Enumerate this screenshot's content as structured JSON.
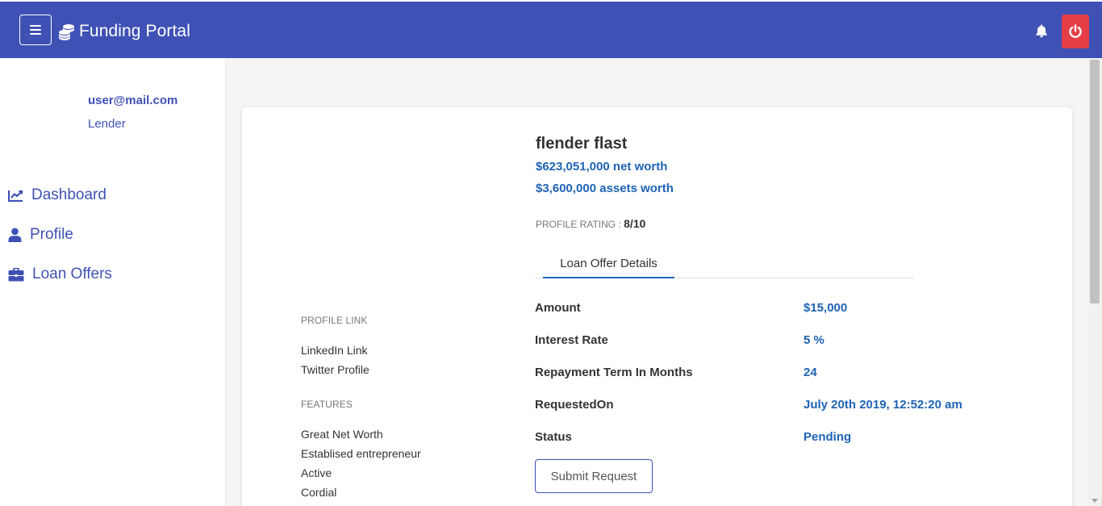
{
  "header": {
    "brand": "Funding Portal",
    "menu_icon": "hamburger-icon",
    "brand_icon": "coins-icon",
    "bell_icon": "bell-icon",
    "power_icon": "power-icon",
    "colors": {
      "navbar": "#3f51b5",
      "power_button": "#e53e46"
    }
  },
  "sidebar": {
    "email": "user@mail.com",
    "role": "Lender",
    "items": [
      {
        "label": "Dashboard",
        "icon": "chart-line-icon"
      },
      {
        "label": "Profile",
        "icon": "user-icon"
      },
      {
        "label": "Loan Offers",
        "icon": "briefcase-icon"
      }
    ]
  },
  "profile": {
    "name": "flender flast",
    "net_worth": "$623,051,000 net worth",
    "assets_worth": "$3,600,000 assets worth",
    "rating_label": "PROFILE RATING :",
    "rating_value": "8/10"
  },
  "tabs": [
    {
      "label": "Loan Offer Details",
      "active": true
    }
  ],
  "left": {
    "profile_link_heading": "PROFILE LINK",
    "links": [
      "LinkedIn Link",
      "Twitter Profile"
    ],
    "features_heading": "FEATURES",
    "features": [
      "Great Net Worth",
      "Establised entrepreneur",
      "Active",
      "Cordial"
    ]
  },
  "details": [
    {
      "label": "Amount",
      "value": "$15,000"
    },
    {
      "label": "Interest Rate",
      "value": "5 %"
    },
    {
      "label": "Repayment Term In Months",
      "value": "24"
    },
    {
      "label": "RequestedOn",
      "value": "July 20th 2019, 12:52:20 am"
    },
    {
      "label": "Status",
      "value": "Pending"
    }
  ],
  "actions": {
    "submit_label": "Submit Request"
  },
  "colors": {
    "accent": "#3f51b5",
    "value_blue": "#1e63b5"
  }
}
